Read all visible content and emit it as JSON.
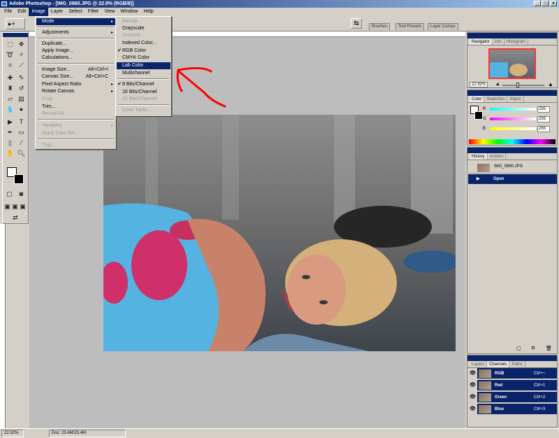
{
  "app": {
    "title": "Adobe Photoshop - [IMG_0860.JPG @ 22.9% (RGB/8)]",
    "window_buttons": [
      "_",
      "□",
      "x"
    ]
  },
  "menubar": [
    "File",
    "Edit",
    "Image",
    "Layer",
    "Select",
    "Filter",
    "View",
    "Window",
    "Help"
  ],
  "options_bar": {
    "tool_glyph": "▸+",
    "partial_label": "ols",
    "well_tabs": [
      "Brushes",
      "Tool Presets",
      "Layer Comps"
    ]
  },
  "image_menu": {
    "items": [
      {
        "label": "Mode",
        "arrow": "▸",
        "highlight": true
      },
      {
        "label": "Adjustments",
        "arrow": "▸"
      },
      {
        "label": "Duplicate..."
      },
      {
        "label": "Apply Image..."
      },
      {
        "label": "Calculations..."
      },
      {
        "label": "Image Size...",
        "shortcut": "Alt+Ctrl+I"
      },
      {
        "label": "Canvas Size...",
        "shortcut": "Alt+Ctrl+C"
      },
      {
        "label": "Pixel Aspect Ratio",
        "arrow": "▸"
      },
      {
        "label": "Rotate Canvas",
        "arrow": "▸"
      },
      {
        "label": "Crop",
        "disabled": true
      },
      {
        "label": "Trim..."
      },
      {
        "label": "Reveal All",
        "disabled": true
      },
      {
        "label": "Variables",
        "arrow": "▸",
        "disabled": true
      },
      {
        "label": "Apply Data Set...",
        "disabled": true
      },
      {
        "label": "Trap...",
        "disabled": true
      }
    ]
  },
  "mode_submenu": {
    "items": [
      {
        "label": "Bitmap",
        "disabled": true
      },
      {
        "label": "Grayscale"
      },
      {
        "label": "Duotone",
        "disabled": true
      },
      {
        "label": "Indexed Color..."
      },
      {
        "label": "RGB Color",
        "checked": true
      },
      {
        "label": "CMYK Color"
      },
      {
        "label": "Lab Color",
        "highlight": true
      },
      {
        "label": "Multichannel"
      },
      {
        "label": "8 Bits/Channel",
        "checked": true
      },
      {
        "label": "16 Bits/Channel"
      },
      {
        "label": "32 Bits/Channel",
        "disabled": true
      },
      {
        "label": "Color Table...",
        "disabled": true
      }
    ],
    "check_glyph": "✔"
  },
  "navigator": {
    "tabs": [
      "Navigator",
      "Info",
      "Histogram"
    ],
    "zoom": "22.92%"
  },
  "color_panel": {
    "tabs": [
      "Color",
      "Swatches",
      "Styles"
    ],
    "channels": [
      {
        "label": "R",
        "value": "255"
      },
      {
        "label": "G",
        "value": "255"
      },
      {
        "label": "B",
        "value": "255"
      }
    ]
  },
  "history": {
    "tabs": [
      "History",
      "Actions"
    ],
    "snapshot": "IMG_0860.JPG",
    "states": [
      "Open"
    ]
  },
  "channels_panel": {
    "tabs": [
      "Layers",
      "Channels",
      "Paths"
    ],
    "rows": [
      {
        "name": "RGB",
        "shortcut": "Ctrl+~"
      },
      {
        "name": "Red",
        "shortcut": "Ctrl+1"
      },
      {
        "name": "Green",
        "shortcut": "Ctrl+2"
      },
      {
        "name": "Blue",
        "shortcut": "Ctrl+3"
      }
    ]
  },
  "status": {
    "zoom": "22.92%",
    "doc": "Doc: 23.4M/23.4M"
  },
  "annotation": {
    "color": "#ff0000"
  }
}
